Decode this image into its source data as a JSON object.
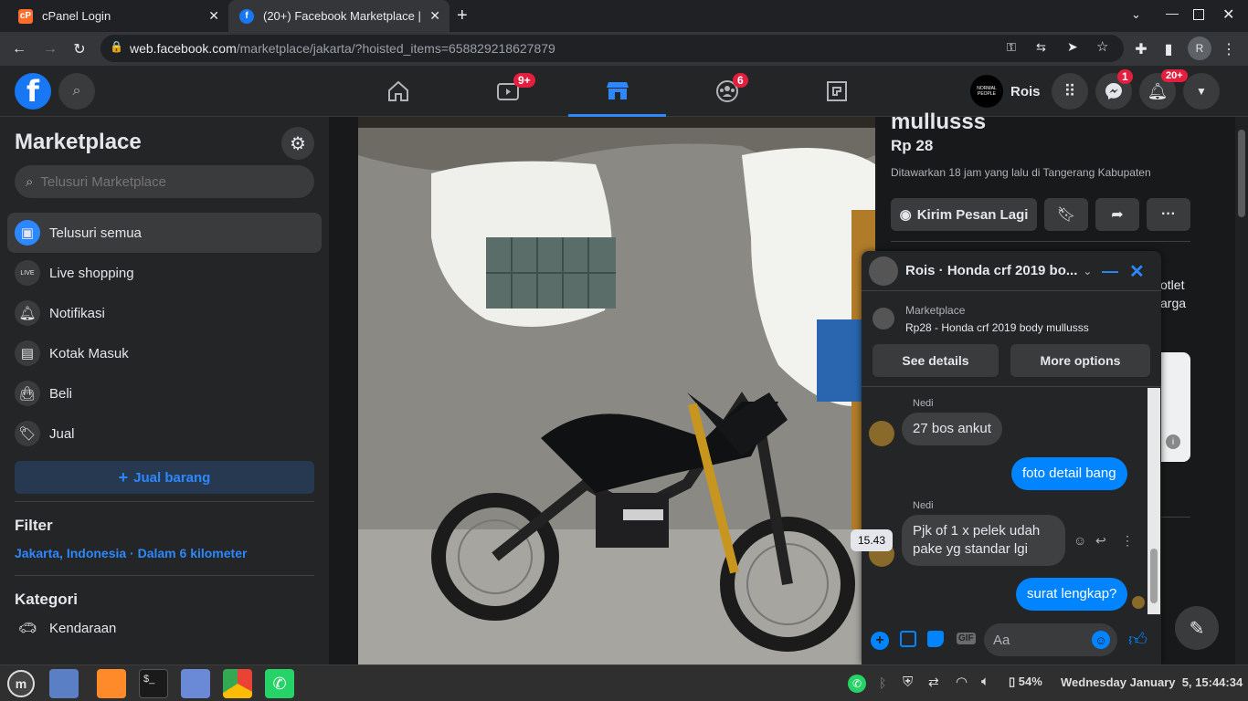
{
  "browser": {
    "tabs": [
      {
        "title": "cPanel Login"
      },
      {
        "title": "(20+) Facebook Marketplace |"
      }
    ],
    "url_host": "web.facebook.com",
    "url_path": "/marketplace/jakarta/?hoisted_items=658829218627879",
    "profile_initial": "R"
  },
  "header": {
    "profile_name": "Rois",
    "badges": {
      "watch": "9+",
      "groups": "6",
      "messenger": "1",
      "notifications": "20+"
    },
    "avatar_text": "NORMAL PEOPLE"
  },
  "sidebar": {
    "title": "Marketplace",
    "search_placeholder": "Telusuri Marketplace",
    "items": [
      {
        "label": "Telusuri semua",
        "icon": "storefront-icon"
      },
      {
        "label": "Live shopping",
        "icon": "live-icon"
      },
      {
        "label": "Notifikasi",
        "icon": "bell-icon"
      },
      {
        "label": "Kotak Masuk",
        "icon": "inbox-icon"
      },
      {
        "label": "Beli",
        "icon": "bag-icon"
      },
      {
        "label": "Jual",
        "icon": "tag-icon"
      }
    ],
    "sell_button": "Jual barang",
    "filter_title": "Filter",
    "filter_value": "Jakarta, Indonesia · Dalam 6 kilometer",
    "category_title": "Kategori",
    "category_first": "Kendaraan"
  },
  "listing": {
    "title": "mullusss",
    "price": "Rp 28",
    "meta": "Ditawarkan 18 jam yang lalu di Tangerang Kabupaten",
    "message_button": "Kirim Pesan Lagi",
    "side_text_1": "otlet",
    "side_text_2": "arga",
    "map_info": "i"
  },
  "chat": {
    "title": "Rois · Honda crf 2019 bo...",
    "listing_source": "Marketplace",
    "listing_name": "Rp28 - Honda crf 2019 body mullusss",
    "see_details": "See details",
    "more_options": "More options",
    "messages": [
      {
        "sender": "Nedi",
        "text": "27 bos ankut",
        "dir": "in"
      },
      {
        "text": "foto detail bang",
        "dir": "out"
      },
      {
        "sender": "Nedi",
        "text": "Pjk of 1 x pelek udah pake yg standar lgi",
        "dir": "in",
        "time": "15.43"
      },
      {
        "text": "surat lengkap?",
        "dir": "out"
      }
    ],
    "input_placeholder": "Aa"
  },
  "taskbar": {
    "battery": "54%",
    "datetime": "Wednesday January  5, 15:44:34"
  },
  "colors": {
    "fb_blue": "#2d88ff",
    "messenger_blue": "#0084ff",
    "badge_red": "#e41e3f"
  }
}
